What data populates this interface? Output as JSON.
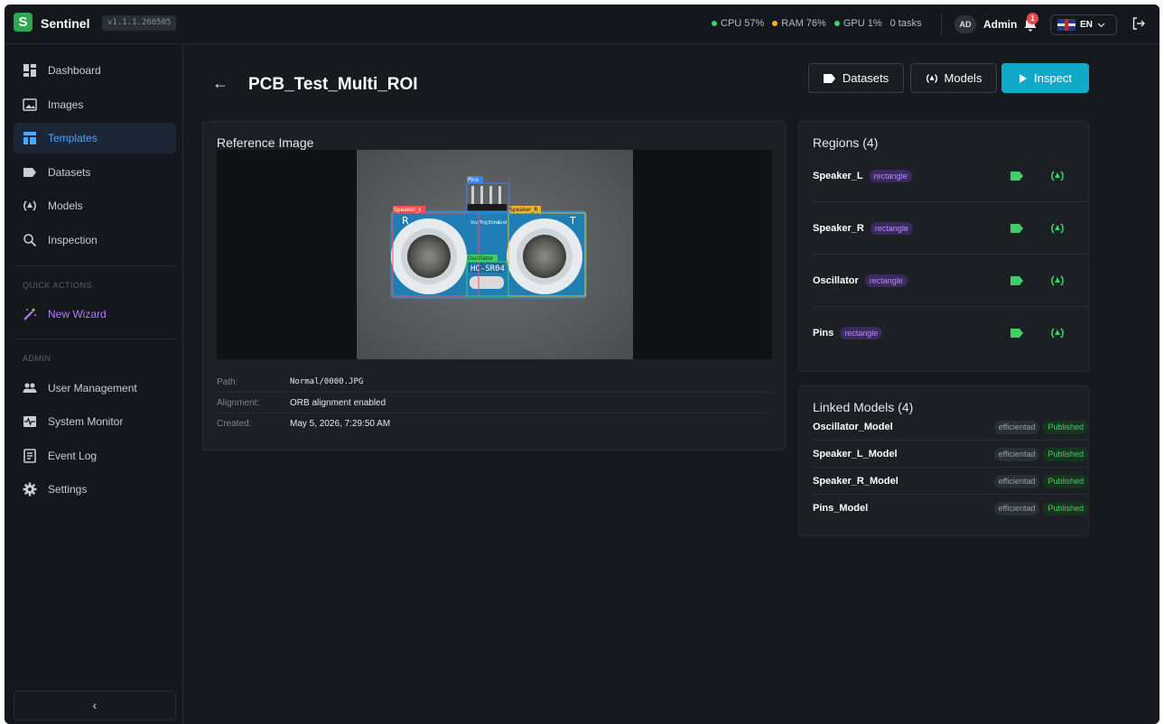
{
  "app": {
    "logo_letter": "S",
    "brand": "Sentinel",
    "version": "v1.1.1.260505"
  },
  "status": {
    "cpu": "CPU 57%",
    "ram": "RAM 76%",
    "gpu": "GPU 1%",
    "tasks": "0 tasks",
    "colors": {
      "cpu": "#3fcf6a",
      "ram": "#f0b429",
      "gpu": "#3fcf6a"
    }
  },
  "user": {
    "initials": "AD",
    "name": "Admin",
    "notification_count": "1",
    "language": "EN"
  },
  "sidebar": {
    "items": [
      {
        "label": "Dashboard",
        "icon": "dashboard-icon"
      },
      {
        "label": "Images",
        "icon": "image-icon"
      },
      {
        "label": "Templates",
        "icon": "templates-icon",
        "active": true
      },
      {
        "label": "Datasets",
        "icon": "dataset-tag-icon"
      },
      {
        "label": "Models",
        "icon": "model-icon"
      },
      {
        "label": "Inspection",
        "icon": "search-icon"
      }
    ],
    "quick_actions_label": "QUICK ACTIONS",
    "quick_actions": [
      {
        "label": "New Wizard",
        "icon": "magic-wand-icon"
      }
    ],
    "admin_label": "ADMIN",
    "admin_items": [
      {
        "label": "User Management",
        "icon": "users-icon"
      },
      {
        "label": "System Monitor",
        "icon": "monitor-icon"
      },
      {
        "label": "Event Log",
        "icon": "log-icon"
      },
      {
        "label": "Settings",
        "icon": "gear-icon"
      }
    ],
    "collapse_glyph": "‹"
  },
  "page": {
    "back_glyph": "←",
    "title": "PCB_Test_Multi_ROI",
    "actions": {
      "datasets": "Datasets",
      "models": "Models",
      "inspect": "Inspect"
    }
  },
  "reference": {
    "title": "Reference Image",
    "roi_labels": {
      "speaker_l": "Speaker_L",
      "speaker_r": "Speaker_R",
      "pins": "Pins",
      "oscillator": "Oscillator"
    },
    "board_marks": {
      "left": "R",
      "right": "T",
      "chip": "HC-SR04",
      "pin_labels": [
        "Vcc",
        "Trig",
        "Echo",
        "Gnd"
      ]
    },
    "meta": [
      {
        "key": "Path:",
        "value": "Normal/0000.JPG",
        "mono": true
      },
      {
        "key": "Alignment:",
        "value": "ORB alignment enabled"
      },
      {
        "key": "Created:",
        "value": "May 5, 2026, 7:29:50 AM"
      }
    ]
  },
  "regions": {
    "title": "Regions (4)",
    "items": [
      {
        "name": "Speaker_L",
        "shape": "rectangle"
      },
      {
        "name": "Speaker_R",
        "shape": "rectangle"
      },
      {
        "name": "Oscillator",
        "shape": "rectangle"
      },
      {
        "name": "Pins",
        "shape": "rectangle"
      }
    ]
  },
  "linked_models": {
    "title": "Linked Models (4)",
    "items": [
      {
        "name": "Oscillator_Model",
        "arch": "efficientad",
        "status": "Published"
      },
      {
        "name": "Speaker_L_Model",
        "arch": "efficientad",
        "status": "Published"
      },
      {
        "name": "Speaker_R_Model",
        "arch": "efficientad",
        "status": "Published"
      },
      {
        "name": "Pins_Model",
        "arch": "efficientad",
        "status": "Published"
      }
    ]
  }
}
